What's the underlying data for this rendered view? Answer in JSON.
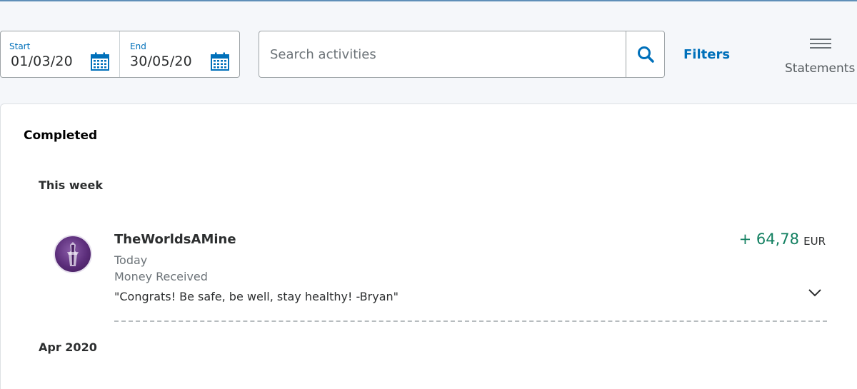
{
  "date_range": {
    "start_label": "Start",
    "start_value": "01/03/20",
    "end_label": "End",
    "end_value": "30/05/20",
    "calendar_icon": "calendar-icon"
  },
  "search": {
    "placeholder": "Search activities",
    "value": "",
    "icon": "search-icon"
  },
  "filters_label": "Filters",
  "statements": {
    "label": "Statements",
    "icon": "hamburger-menu-icon"
  },
  "activity_list": {
    "section_title": "Completed",
    "groups": [
      {
        "label": "This week",
        "items": [
          {
            "name": "TheWorldsAMine",
            "date": "Today",
            "type": "Money Received",
            "note": "\"Congrats! Be safe, be well, stay healthy! -Bryan\"",
            "amount": "+ 64,78",
            "currency": "EUR"
          }
        ]
      },
      {
        "label": "Apr 2020",
        "items": []
      }
    ]
  },
  "colors": {
    "accent": "#0070ba",
    "positive_amount": "#138061",
    "border": "#9da3a6",
    "background": "#f5f7fa"
  }
}
